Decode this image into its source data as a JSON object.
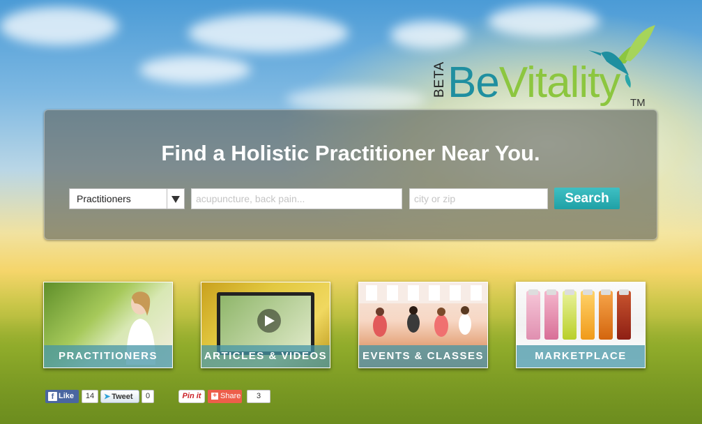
{
  "brand": {
    "beta": "BETA",
    "name_part1": "Be",
    "name_part2": "Vitality",
    "trademark": "TM",
    "colors": {
      "be": "#1f8fa0",
      "vitality": "#8cc63f"
    }
  },
  "search": {
    "headline": "Find a Holistic Practitioner Near You.",
    "category_selected": "Practitioners",
    "query_placeholder": "acupuncture, back pain...",
    "location_placeholder": "city or zip",
    "button_label": "Search",
    "accent_color": "#2ab0b4"
  },
  "tiles": [
    {
      "label": "PRACTITIONERS"
    },
    {
      "label": "ARTICLES & VIDEOS"
    },
    {
      "label": "EVENTS & CLASSES"
    },
    {
      "label": "MARKETPLACE"
    }
  ],
  "social": {
    "fb_label": "Like",
    "fb_count": "14",
    "tweet_label": "Tweet",
    "tweet_count": "0",
    "pin_label": "Pin it",
    "share_label": "Share",
    "share_count": "3"
  }
}
